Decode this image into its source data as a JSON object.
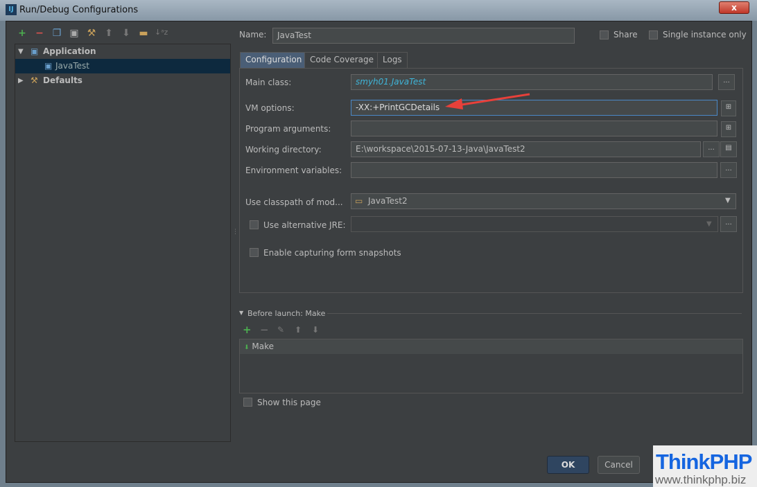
{
  "window": {
    "title": "Run/Debug Configurations",
    "close": "x"
  },
  "toolbar": {
    "icons": [
      "plus-icon",
      "minus-icon",
      "copy-icon",
      "save-icon",
      "wrench-icon",
      "arrow-up-icon",
      "arrow-down-icon",
      "folder-icon",
      "sort-icon"
    ]
  },
  "tree": {
    "items": [
      {
        "label": "Application",
        "expanded": true
      },
      {
        "label": "JavaTest",
        "selected": true
      },
      {
        "label": "Defaults",
        "expanded": false
      }
    ]
  },
  "header": {
    "name_label": "Name:",
    "name_value": "JavaTest",
    "share": "Share",
    "single_instance": "Single instance only"
  },
  "tabs": [
    {
      "label": "Configuration",
      "active": true
    },
    {
      "label": "Code Coverage"
    },
    {
      "label": "Logs"
    }
  ],
  "form": {
    "main_class_label": "Main class:",
    "main_class": "smyh01.JavaTest",
    "vm_options_label": "VM options:",
    "vm_options": "-XX:+PrintGCDetails",
    "program_args_label": "Program arguments:",
    "program_args": "",
    "working_dir_label": "Working directory:",
    "working_dir": "E:\\workspace\\2015-07-13-Java\\JavaTest2",
    "env_label": "Environment variables:",
    "env": "",
    "classpath_label": "Use classpath of mod...",
    "classpath": "JavaTest2",
    "alt_jre_label": "Use alternative JRE:",
    "snapshots_label": "Enable capturing form snapshots",
    "ellipsis": "..."
  },
  "before_launch": {
    "title": "Before launch: Make",
    "items": [
      "Make"
    ],
    "show_page": "Show this page"
  },
  "buttons": {
    "ok": "OK",
    "cancel": "Cancel"
  },
  "watermark": {
    "logo": "ThinkPHP",
    "url": "www.thinkphp.biz"
  },
  "colors": {
    "bg": "#3c3f41",
    "selection": "#0d293e",
    "accent": "#2f4560",
    "annotation_arrow": "#e8403a"
  }
}
